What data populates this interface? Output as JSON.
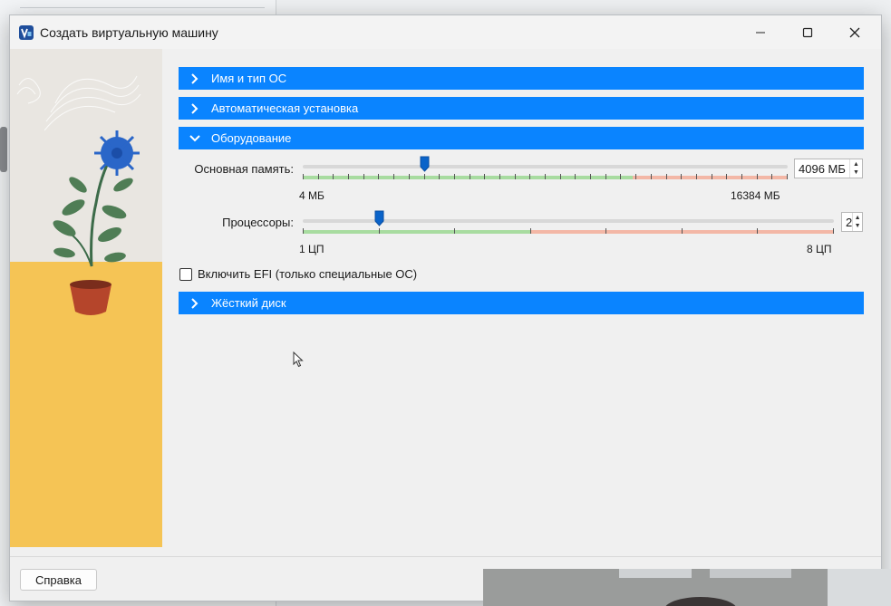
{
  "window": {
    "title": "Создать виртуальную машину",
    "icon": "virtualbox-icon"
  },
  "sections": [
    {
      "label": "Имя и тип ОС",
      "expanded": false
    },
    {
      "label": "Автоматическая установка",
      "expanded": false
    },
    {
      "label": "Оборудование",
      "expanded": true
    },
    {
      "label": "Жёсткий диск",
      "expanded": false
    }
  ],
  "hardware": {
    "memory": {
      "label": "Основная память:",
      "value": "4096 МБ",
      "fraction": 0.25,
      "min_label": "4 МБ",
      "max_label": "16384 МБ"
    },
    "cpu": {
      "label": "Процессоры:",
      "value": "2",
      "fraction": 0.143,
      "min_label": "1 ЦП",
      "max_label": "8 ЦП"
    },
    "efi": {
      "label": "Включить EFI (только специальные ОС)",
      "checked": false
    }
  },
  "footer": {
    "help_label": "Справка"
  },
  "colors": {
    "accent": "#0a84ff",
    "range_green": "#a8dca0",
    "range_red": "#f3b7a6"
  }
}
